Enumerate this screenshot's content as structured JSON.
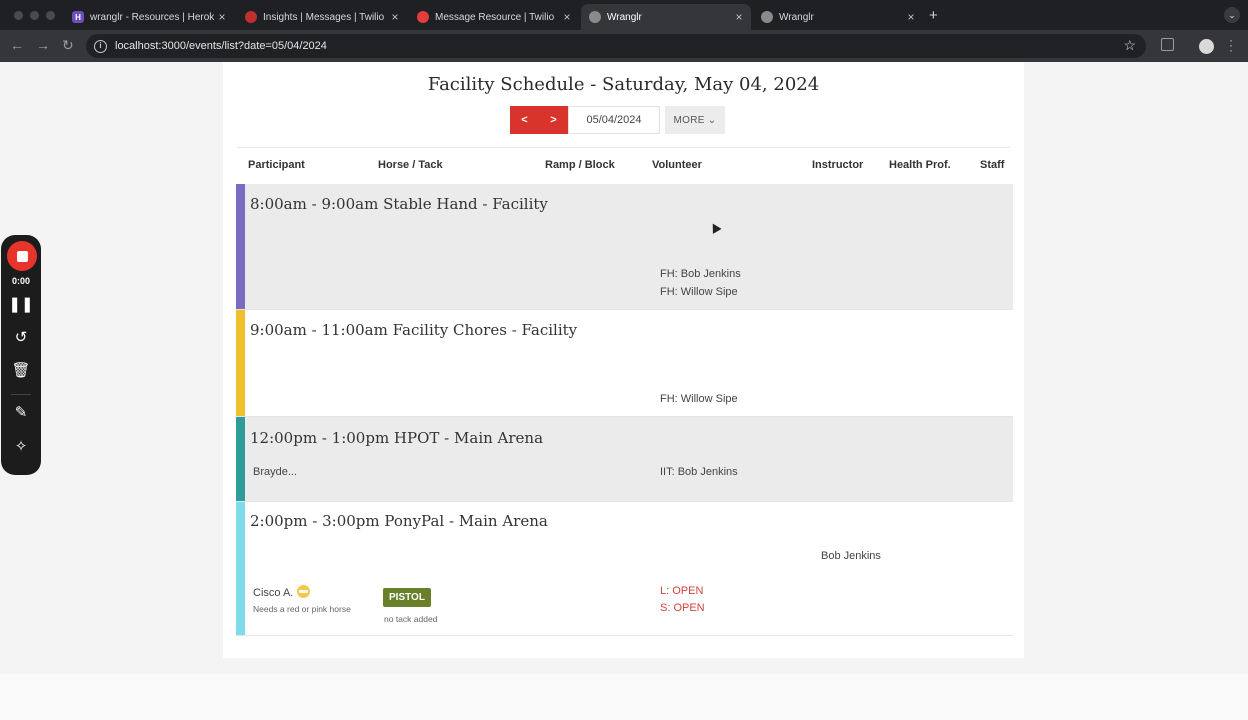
{
  "browser": {
    "tabs": [
      {
        "title": "wranglr - Resources | Heroku",
        "icon": "heroku-icon",
        "color": "#6b4fbb",
        "glyph": "H"
      },
      {
        "title": "Insights | Messages | Twilio",
        "icon": "twilio-icon",
        "color": "#c0302d",
        "glyph": ""
      },
      {
        "title": "Message Resource | Twilio",
        "icon": "twilio-icon",
        "color": "#e23d3a",
        "glyph": ""
      },
      {
        "title": "Wranglr",
        "icon": "globe-icon",
        "color": "#8a8a8a",
        "glyph": ""
      },
      {
        "title": "Wranglr",
        "icon": "globe-icon",
        "color": "#8a8a8a",
        "glyph": ""
      }
    ],
    "active_tab": 3,
    "url": "localhost:3000/events/list?date=05/04/2024"
  },
  "page": {
    "title": "Facility Schedule - Saturday, May 04, 2024",
    "prev_label": "<",
    "next_label": ">",
    "date_value": "05/04/2024",
    "more_label": "MORE ⌄"
  },
  "columns": [
    "Participant",
    "Horse / Tack",
    "Ramp / Block",
    "Volunteer",
    "Instructor",
    "Health Prof.",
    "Staff"
  ],
  "events": [
    {
      "title": "8:00am - 9:00am Stable Hand - Facility",
      "color": "#7a6cc0",
      "background": "#ebebeb",
      "volunteers": [
        "FH: Bob Jenkins",
        "FH: Willow Sipe"
      ]
    },
    {
      "title": "9:00am - 11:00am Facility Chores - Facility",
      "color": "#f0c02c",
      "background": "#ffffff",
      "volunteers": [
        "FH: Willow Sipe"
      ]
    },
    {
      "title": "12:00pm - 1:00pm HPOT - Main Arena",
      "color": "#2e9c9a",
      "background": "#ebebeb",
      "participant": "Brayde...",
      "volunteers": [
        "IIT: Bob Jenkins"
      ]
    },
    {
      "title": "2:00pm - 3:00pm PonyPal - Main Arena",
      "color": "#7fdaea",
      "background": "#ffffff",
      "instructor": "Bob Jenkins",
      "participant": "Cisco A.",
      "participant_note": "Needs a red or pink horse",
      "horse": "PISTOL",
      "tack_note": "no tack added",
      "volunteers": [
        "L: OPEN",
        "S: OPEN"
      ]
    }
  ],
  "recorder": {
    "time": "0:00"
  },
  "colors": {
    "accent_red": "#d9342b",
    "horse_tag": "#6a7f2a",
    "open_red": "#d2413a"
  }
}
